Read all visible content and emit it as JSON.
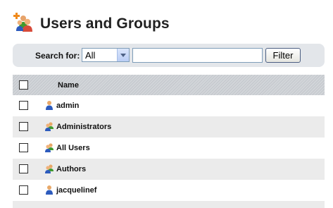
{
  "page": {
    "title": "Users and Groups"
  },
  "search": {
    "label": "Search for:",
    "select_value": "All",
    "input_value": "",
    "filter_label": "Filter"
  },
  "table": {
    "header_name": "Name",
    "rows": [
      {
        "name": "admin",
        "type": "user"
      },
      {
        "name": "Administrators",
        "type": "group"
      },
      {
        "name": "All Users",
        "type": "group"
      },
      {
        "name": "Authors",
        "type": "group"
      },
      {
        "name": "jacquelinef",
        "type": "user"
      }
    ]
  },
  "colors": {
    "user_icon": "#2d5bbd",
    "group_icon": "#3f9a2f",
    "title_accent": "#f08a1c"
  },
  "icons": {
    "title": "users-groups-add-icon",
    "user": "user-icon",
    "group": "group-icon"
  }
}
